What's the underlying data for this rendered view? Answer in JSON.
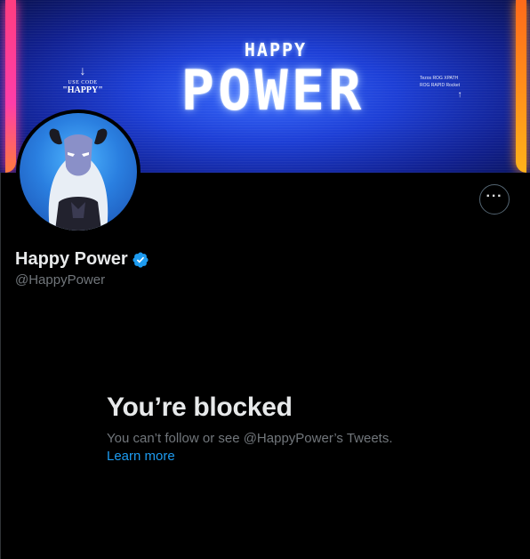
{
  "banner": {
    "use_code_line": "USE CODE",
    "code": "\"HAPPY\"",
    "title_small": "HAPPY",
    "title_big": "POWER",
    "sponsor_line_1": "Tezos  ROG  XPATH",
    "sponsor_line_2": "ROG  RAPID  Rocket",
    "arrow_down": "↓",
    "arrow_up": "↑"
  },
  "profile": {
    "display_name": "Happy Power",
    "handle": "@HappyPower",
    "verified": true,
    "more_label": "···"
  },
  "blocked": {
    "title": "You’re blocked",
    "message": "You can’t follow or see @HappyPower’s Tweets.",
    "learn_more": "Learn more"
  },
  "colors": {
    "background": "#000000",
    "primary_text": "#e7e9ea",
    "secondary_text": "#71767b",
    "link": "#1d9bf0",
    "verified_badge": "#1d9bf0"
  },
  "icons": {
    "more": "more-horizontal-icon",
    "verified": "verified-badge-icon"
  }
}
